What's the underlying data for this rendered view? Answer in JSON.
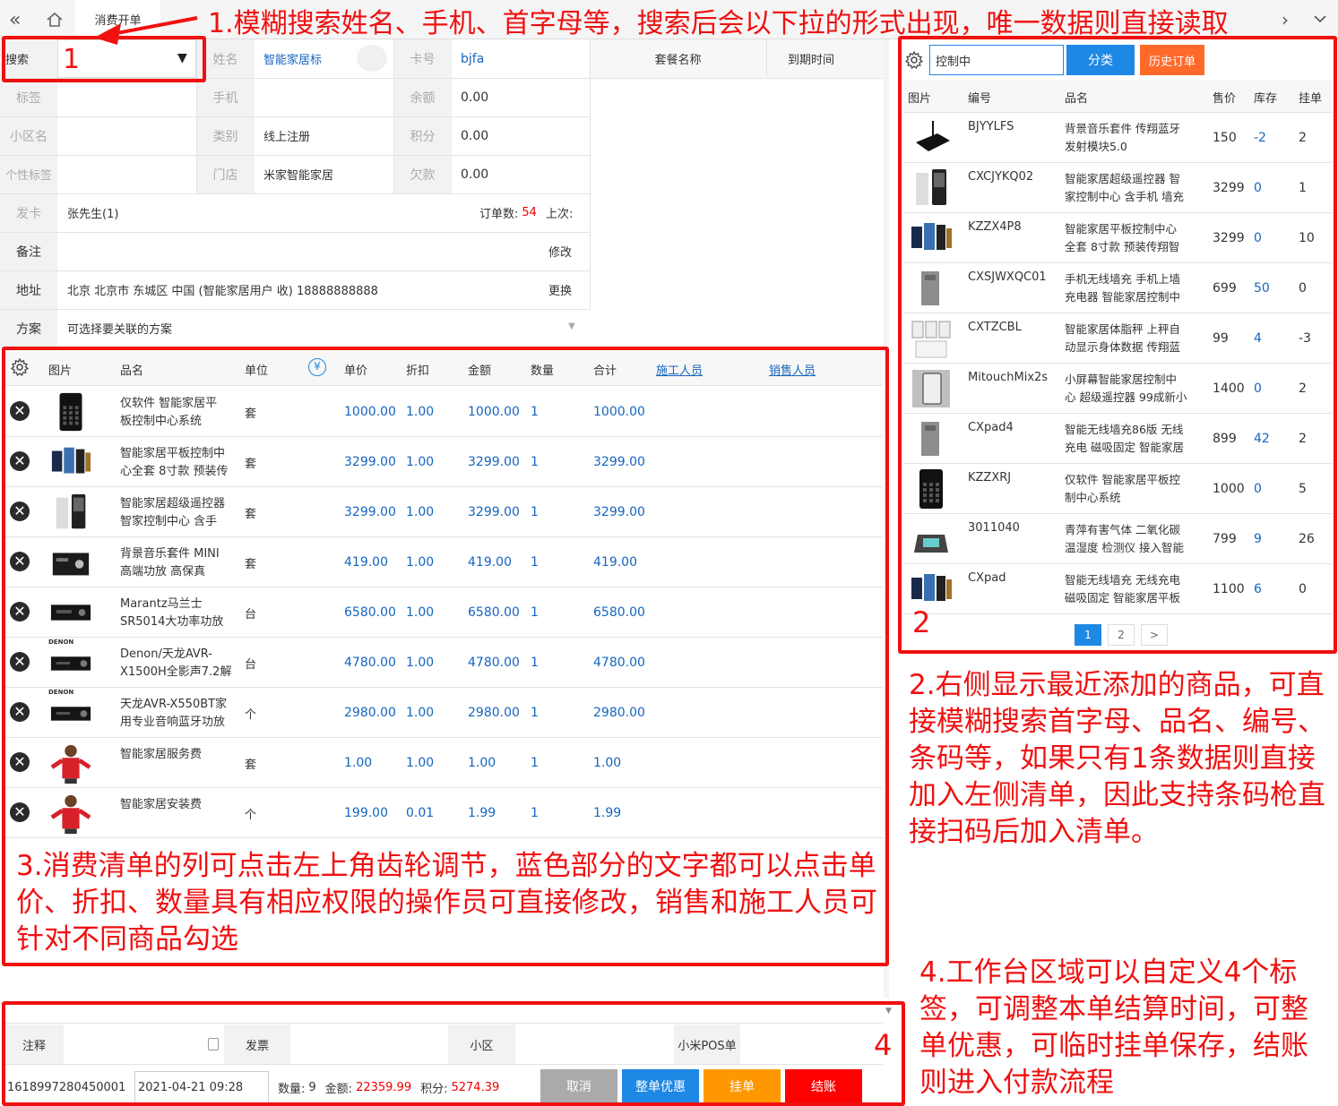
{
  "tab_title": "消费开单",
  "customer": {
    "search_label": "搜索",
    "search_value": "1",
    "name_label": "姓名",
    "name_value": "智能家居标",
    "card_label": "卡号",
    "card_value": "bjfa",
    "package_header": "套餐名称",
    "expire_header": "到期时间",
    "tag_label": "标签",
    "phone_label": "手机",
    "balance_label": "余额",
    "balance_value": "0.00",
    "community_label": "小区名",
    "category_label": "类别",
    "category_value": "线上注册",
    "points_label": "积分",
    "points_value": "0.00",
    "personal_tag_label": "个性标签",
    "store_label": "门店",
    "store_value": "米家智能家居",
    "debt_label": "欠款",
    "debt_value": "0.00",
    "card_issue_label": "发卡",
    "card_issue_value": "张先生(1)",
    "order_count_label": "订单数:",
    "order_count_value": "54",
    "last_label": "上次:",
    "remark_label": "备注",
    "remark_action": "修改",
    "address_label": "地址",
    "address_value": "北京 北京市 东城区 中国 (智能家居用户 收) 18888888888",
    "address_action": "更换",
    "plan_label": "方案",
    "plan_placeholder": "可选择要关联的方案"
  },
  "order": {
    "headers": {
      "image": "图片",
      "name": "品名",
      "unit": "单位",
      "price": "单价",
      "discount": "折扣",
      "amount": "金额",
      "qty": "数量",
      "total": "合计",
      "installer": "施工人员",
      "sales": "销售人员"
    },
    "rows": [
      {
        "name1": "仅软件 智能家居平",
        "name2": "板控制中心系统",
        "unit": "套",
        "price": "1000.00",
        "discount": "1.00",
        "amount": "1000.00",
        "qty": "1",
        "total": "1000.00",
        "icon": "tablet-black-icon"
      },
      {
        "name1": "智能家居平板控制中",
        "name2": "心全套 8寸款 预装传",
        "unit": "套",
        "price": "3299.00",
        "discount": "1.00",
        "amount": "3299.00",
        "qty": "1",
        "total": "3299.00",
        "icon": "tablets-icon"
      },
      {
        "name1": "智能家居超级遥控器",
        "name2": "智家控制中心 含手",
        "unit": "套",
        "price": "3299.00",
        "discount": "1.00",
        "amount": "3299.00",
        "qty": "1",
        "total": "3299.00",
        "icon": "remote-icon"
      },
      {
        "name1": "背景音乐套件 MINI",
        "name2": "高端功放 高保真",
        "unit": "套",
        "price": "419.00",
        "discount": "1.00",
        "amount": "419.00",
        "qty": "1",
        "total": "419.00",
        "icon": "amplifier-icon"
      },
      {
        "name1": "Marantz马兰士",
        "name2": "SR5014大功率功放",
        "unit": "台",
        "price": "6580.00",
        "discount": "1.00",
        "amount": "6580.00",
        "qty": "1",
        "total": "6580.00",
        "icon": "av-receiver-icon"
      },
      {
        "name1": "Denon/天龙AVR-",
        "name2": "X1500H全影声7.2解",
        "unit": "台",
        "price": "4780.00",
        "discount": "1.00",
        "amount": "4780.00",
        "qty": "1",
        "total": "4780.00",
        "icon": "denon-receiver-icon",
        "brand": "DENON"
      },
      {
        "name1": "天龙AVR-X550BT家",
        "name2": "用专业音响蓝牙功放",
        "unit": "个",
        "price": "2980.00",
        "discount": "1.00",
        "amount": "2980.00",
        "qty": "1",
        "total": "2980.00",
        "icon": "denon-receiver-icon",
        "brand": "DENON"
      },
      {
        "name1": "智能家居服务费",
        "name2": "",
        "unit": "套",
        "price": "1.00",
        "discount": "1.00",
        "amount": "1.00",
        "qty": "1",
        "total": "1.00",
        "icon": "service-person-icon"
      },
      {
        "name1": "智能家居安装费",
        "name2": "",
        "unit": "个",
        "price": "199.00",
        "discount": "0.01",
        "amount": "1.99",
        "qty": "1",
        "total": "1.99",
        "icon": "service-person-icon"
      }
    ]
  },
  "products": {
    "search_value": "控制中",
    "classify_button": "分类",
    "history_button": "历史订单",
    "headers": {
      "image": "图片",
      "code": "编号",
      "name": "品名",
      "price": "售价",
      "stock": "库存",
      "hold": "挂单"
    },
    "rows": [
      {
        "code": "BJYYLFS",
        "name1": "背景音乐套件 传翔蓝牙",
        "name2": "发射模块5.0",
        "price": "150",
        "stock": "-2",
        "hold": "2",
        "icon": "bluetooth-module-icon"
      },
      {
        "code": "CXCJYKQ02",
        "name1": "智能家居超级遥控器 智",
        "name2": "家控制中心 含手机 墙充",
        "price": "3299",
        "stock": "0",
        "hold": "1",
        "icon": "remote-icon"
      },
      {
        "code": "KZZX4P8",
        "name1": "智能家居平板控制中心",
        "name2": "全套 8寸款 预装传翔智",
        "price": "3299",
        "stock": "0",
        "hold": "10",
        "icon": "tablets-icon"
      },
      {
        "code": "CXSJWXQC01",
        "name1": "手机无线墙充 手机上墙",
        "name2": "充电器 智能家居控制中",
        "price": "699",
        "stock": "50",
        "hold": "0",
        "icon": "wall-charger-icon"
      },
      {
        "code": "CXTZCBL",
        "name1": "智能家居体脂秤 上秤自",
        "name2": "动显示身体数据 传翔蓝",
        "price": "99",
        "stock": "4",
        "hold": "-3",
        "icon": "scale-icon"
      },
      {
        "code": "MitouchMix2s",
        "name1": "小屏幕智能家居控制中",
        "name2": "心 超级遥控器 99成新小",
        "price": "1400",
        "stock": "0",
        "hold": "2",
        "icon": "phone-hand-icon"
      },
      {
        "code": "CXpad4",
        "name1": "智能无线墙充86版 无线",
        "name2": "充电 磁吸固定 智能家居",
        "price": "899",
        "stock": "42",
        "hold": "2",
        "icon": "wall-charger-icon"
      },
      {
        "code": "KZZXRJ",
        "name1": "仅软件 智能家居平板控",
        "name2": "制中心系统",
        "price": "1000",
        "stock": "0",
        "hold": "5",
        "icon": "tablet-black-icon"
      },
      {
        "code": "3011040",
        "name1": "青萍有害气体 二氧化碳",
        "name2": "温湿度 检测仪 接入智能",
        "price": "799",
        "stock": "9",
        "hold": "26",
        "icon": "air-monitor-icon"
      },
      {
        "code": "CXpad",
        "name1": "智能无线墙充 无线充电",
        "name2": "磁吸固定 智能家居平板",
        "price": "1100",
        "stock": "6",
        "hold": "0",
        "icon": "tablets-icon"
      }
    ],
    "pages": [
      "1",
      "2",
      ">"
    ]
  },
  "footer": {
    "note_label": "注释",
    "invoice_label": "发票",
    "community_label": "小区",
    "pos_label": "小米POS单",
    "order_no": "1618997280450001",
    "datetime": "2021-04-21 09:28",
    "qty_label": "数量:",
    "qty_value": "9",
    "amount_label": "金额:",
    "amount_value": "22359.99",
    "points_label": "积分:",
    "points_value": "5274.39",
    "cancel_button": "取消",
    "discount_button": "整单优惠",
    "hold_button": "挂单",
    "checkout_button": "结账"
  },
  "annotations": {
    "a1": "1.模糊搜索姓名、手机、首字母等，搜索后会以下拉的形式出现，唯一数据则直接读取",
    "a2": "2.右侧显示最近添加的商品，可直接模糊搜索首字母、品名、编号、条码等，如果只有1条数据则直接加入左侧清单，因此支持条码枪直接扫码后加入清单。",
    "a3": "3.消费清单的列可点击左上角齿轮调节，蓝色部分的文字都可以点击单价、折扣、数量具有相应权限的操作员可直接修改，销售和施工人员可针对不同商品勾选",
    "a4": "4.工作台区域可以自定义4个标签，可调整本单结算时间，可整单优惠，可临时挂单保存，结账则进入付款流程",
    "n1": "1",
    "n2": "2",
    "n4": "4"
  },
  "colors": {
    "accent_blue": "#1e88e5",
    "history_orange": "#ff6a2b",
    "hold_orange": "#ff9800",
    "checkout_red": "#ff0000",
    "cancel_gray": "#aaaaaa",
    "discount_blue": "#1e88e5",
    "annotation_red": "#f01010"
  }
}
